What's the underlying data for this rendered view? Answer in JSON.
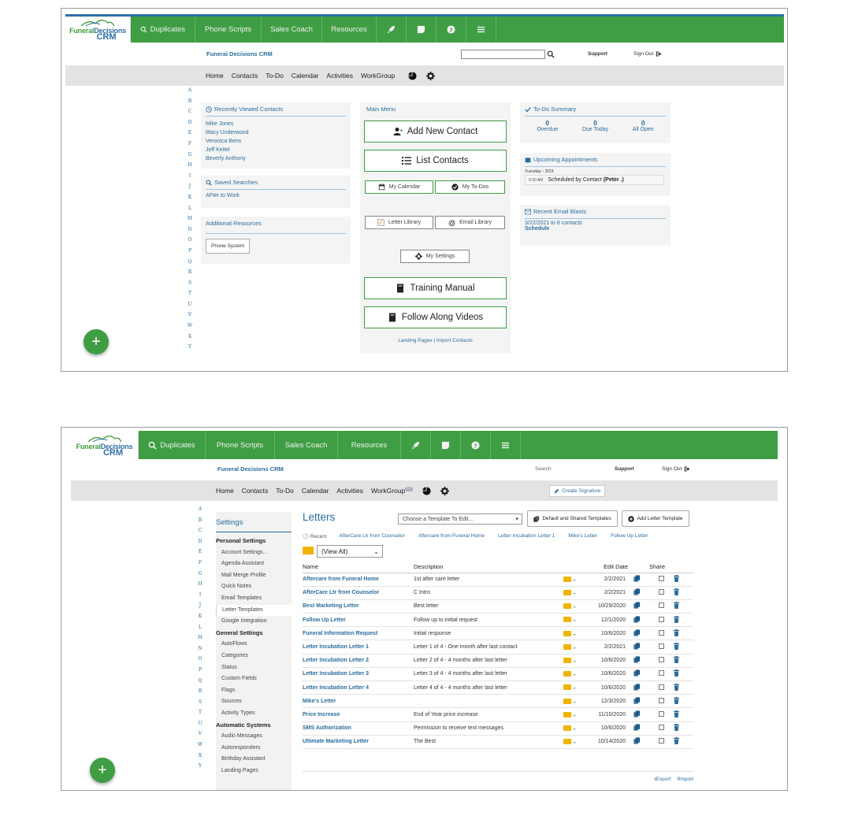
{
  "brand": {
    "line1_a": "Funeral",
    "line1_b": "Decisions",
    "line2": "CRM"
  },
  "nav": {
    "duplicates": "Duplicates",
    "phone_scripts": "Phone Scripts",
    "sales_coach": "Sales Coach",
    "resources": "Resources"
  },
  "subheader": {
    "title": "Funeral Decisions CRM",
    "support": "Support",
    "sign_out": "Sign Out",
    "search_label": "Search"
  },
  "menu": {
    "home": "Home",
    "contacts": "Contacts",
    "todo": "To-Do",
    "calendar": "Calendar",
    "activities": "Activities",
    "workgroup": "WorkGroup",
    "workgroup_badge_1": "",
    "workgroup_badge_2": "17"
  },
  "alphabet": [
    "A",
    "B",
    "C",
    "D",
    "E",
    "F",
    "G",
    "H",
    "I",
    "J",
    "K",
    "L",
    "M",
    "N",
    "O",
    "P",
    "Q",
    "R",
    "S",
    "T",
    "U",
    "V",
    "W",
    "X",
    "Y"
  ],
  "dashboard": {
    "recent_title": "Recently Viewed Contacts",
    "recent_contacts": [
      "Mike Jones",
      "Macy Underwood",
      "Veronica Bens",
      "Jeff Keitel",
      "Beverly Anthony"
    ],
    "saved_title": "Saved Searches",
    "saved_items": [
      "AFter to Work"
    ],
    "additional_title": "Additional Resources",
    "phone_system": "Phone System",
    "main_menu_title": "Main Menu",
    "add_new_contact": "Add New Contact",
    "list_contacts": "List Contacts",
    "my_calendar": "My Calendar",
    "my_todos": "My To-Dos",
    "letter_library": "Letter Library",
    "email_library": "Email Library",
    "my_settings": "My Settings",
    "training_manual": "Training Manual",
    "follow_along": "Follow Along Videos",
    "landing_pages": "Landing Pages",
    "import_contacts": "Import Contacts",
    "link_sep": "|",
    "todo_title": "To-Do Summary",
    "todo_counts": [
      {
        "num": "0",
        "label": "Overdue"
      },
      {
        "num": "0",
        "label": "Due Today"
      },
      {
        "num": "0",
        "label": "All Open"
      }
    ],
    "appointments_title": "Upcoming Appointments",
    "appt_date": "Tuesday - 3/23",
    "appt_time": "9:30 AM",
    "appt_text": "Scheduled by Contact",
    "appt_who": "(Peter .)",
    "email_blasts_title": "Recent Email Blasts",
    "blast_line": "3/22/2021 to 8 contacts",
    "blast_schedule": "Schedule"
  },
  "letters_page": {
    "create_signature": "Create Signature",
    "settings_title": "Settings",
    "groups": [
      {
        "title": "Personal Settings",
        "items": [
          "Account Settings...",
          "Agenda Assistant",
          "Mail Merge Profile",
          "Quick Notes",
          "Email Templates",
          "Letter Templates",
          "Google Integration"
        ]
      },
      {
        "title": "General Settings",
        "items": [
          "AutoFlows",
          "Categories",
          "Status",
          "Custom Fields",
          "Flags",
          "Sources",
          "Activity Types"
        ]
      },
      {
        "title": "Automatic Systems",
        "items": [
          "Audio Messages",
          "Autoresponders",
          "Birthday Assistant",
          "Landing Pages"
        ]
      }
    ],
    "active_item": "Letter Templates",
    "title": "Letters",
    "template_select": "Choose a Template To Edit...",
    "default_shared_btn": "Default and Shared Templates",
    "add_template_btn": "Add Letter Template",
    "recent_label": "Recent",
    "recent_links": [
      "AfterCare Ltr from Counselor",
      "Aftercare from Funeral Home",
      "Letter Incubation Letter 1",
      "Mike's Letter",
      "Follow Up Letter"
    ],
    "folder_select": "(View All)",
    "columns": {
      "name": "Name",
      "description": "Description",
      "edit_date": "Edit Date",
      "share": "Share"
    },
    "rows": [
      {
        "name": "Aftercare from Funeral Home",
        "desc": "1st after care letter",
        "date": "2/2/2021"
      },
      {
        "name": "AfterCare Ltr from Counselor",
        "desc": "C Intro",
        "date": "2/2/2021"
      },
      {
        "name": "Best Marketing Letter",
        "desc": "Best letter",
        "date": "10/29/2020"
      },
      {
        "name": "Follow Up Letter",
        "desc": "Follow up to initial request",
        "date": "12/1/2020"
      },
      {
        "name": "Funeral Information Request",
        "desc": "Initial response",
        "date": "10/6/2020"
      },
      {
        "name": "Letter Incubation Letter 1",
        "desc": "Letter 1 of 4 - One month after last contact",
        "date": "2/2/2021"
      },
      {
        "name": "Letter Incubation Letter 2",
        "desc": "Letter 2 of 4 - 4 months after last letter",
        "date": "10/6/2020"
      },
      {
        "name": "Letter Incubation Letter 3",
        "desc": "Letter 3 of 4 - 4 months after last letter",
        "date": "10/6/2020"
      },
      {
        "name": "Letter Incubation Letter 4",
        "desc": "Letter 4 of 4 - 4 months after last letter",
        "date": "10/6/2020"
      },
      {
        "name": "Mike's Letter",
        "desc": "",
        "date": "12/3/2020"
      },
      {
        "name": "Price Increase",
        "desc": "End of Year price increase",
        "date": "11/10/2020"
      },
      {
        "name": "SMS Authorization",
        "desc": "Permission to receive text messages",
        "date": "10/6/2020"
      },
      {
        "name": "Ultimate Marketing Letter",
        "desc": "The Best",
        "date": "10/14/2020"
      }
    ],
    "export": "Export",
    "import": "Import"
  },
  "colors": {
    "nav_green": "#3f9d43",
    "link_blue": "#2a6d9e",
    "folder": "#f0b400"
  }
}
